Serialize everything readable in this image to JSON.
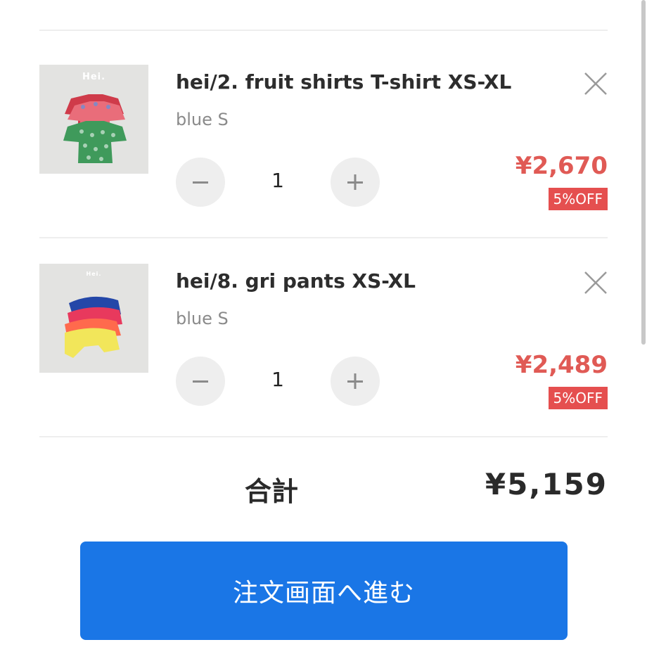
{
  "cart": {
    "items": [
      {
        "brand_mark": "Hei.",
        "title": "hei/2. fruit shirts T-shirt XS-XL",
        "variant": "blue S",
        "quantity": "1",
        "price": "¥2,670",
        "discount": "5%OFF",
        "image_icon": "product-thumbnail"
      },
      {
        "brand_mark": "Hei.",
        "title": "hei/8. gri pants XS-XL",
        "variant": "blue S",
        "quantity": "1",
        "price": "¥2,489",
        "discount": "5%OFF",
        "image_icon": "product-thumbnail"
      }
    ]
  },
  "summary": {
    "total_label": "合計",
    "total_value": "¥5,159"
  },
  "checkout": {
    "button_label": "注文画面へ進む"
  },
  "colors": {
    "accent_blue": "#1a76e6",
    "price_red": "#e05a55",
    "badge_red": "#e54f4f"
  },
  "icons": {
    "remove": "close-icon",
    "decrement": "minus-icon",
    "increment": "plus-icon"
  }
}
